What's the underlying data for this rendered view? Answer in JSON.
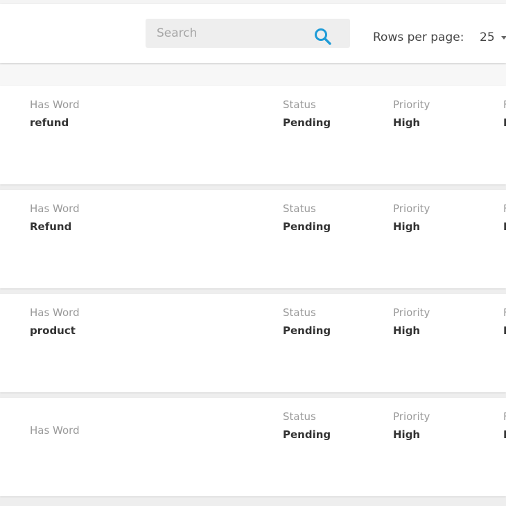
{
  "search": {
    "placeholder": "Search"
  },
  "pagination": {
    "rows_label": "Rows per page:",
    "rows_value": "25"
  },
  "columns": {
    "has_word": "Has Word",
    "status": "Status",
    "priority": "Priority",
    "extra_cut": "F"
  },
  "rows": [
    {
      "has_word": "refund",
      "status": "Pending",
      "priority": "High",
      "extra_cut": "N"
    },
    {
      "has_word": "Refund",
      "status": "Pending",
      "priority": "High",
      "extra_cut": "N"
    },
    {
      "has_word": "product",
      "status": "Pending",
      "priority": "High",
      "extra_cut": "N"
    },
    {
      "has_word": "",
      "status": "Pending",
      "priority": "High",
      "extra_cut": "N"
    }
  ],
  "colors": {
    "accent": "#1e9bd7",
    "page_bg": "#eeeeee",
    "card_bg": "#ffffff"
  },
  "icons": {
    "search": "search-icon",
    "dropdown": "caret-down-icon"
  }
}
